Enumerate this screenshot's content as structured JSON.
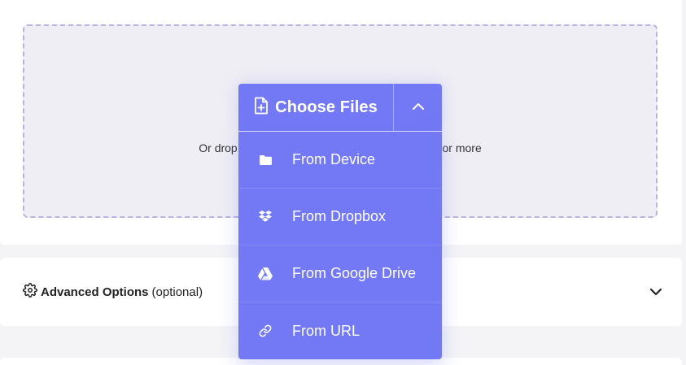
{
  "upload": {
    "drop_text_left": "Or drop",
    "drop_text_right": "or more"
  },
  "choose_files": {
    "label": "Choose Files",
    "toggle_icon": "chevron-up-icon"
  },
  "menu": {
    "items": [
      {
        "label": "From Device",
        "icon": "folder-icon"
      },
      {
        "label": "From Dropbox",
        "icon": "dropbox-icon"
      },
      {
        "label": "From Google Drive",
        "icon": "google-drive-icon"
      },
      {
        "label": "From URL",
        "icon": "link-icon"
      }
    ]
  },
  "advanced_options": {
    "label_bold": "Advanced Options",
    "label_optional": "(optional)",
    "icon": "gear-icon",
    "expand_icon": "chevron-down-icon"
  },
  "colors": {
    "accent": "#7379f5",
    "dropzone_bg": "#efeef4",
    "dropzone_border": "#b9b3de"
  }
}
